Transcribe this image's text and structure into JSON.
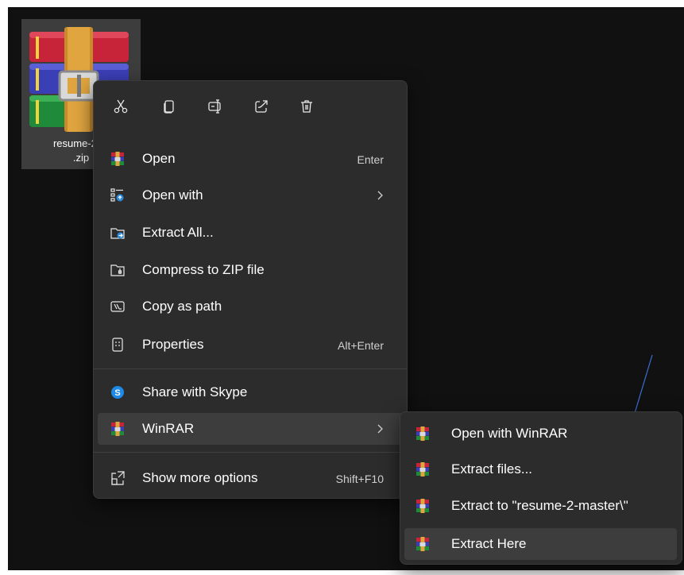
{
  "file": {
    "name": "resume-2-m\n.zip",
    "icon": "winrar-archive-icon"
  },
  "quick_actions": [
    {
      "name": "cut",
      "icon": "scissors-icon"
    },
    {
      "name": "copy",
      "icon": "copy-icon"
    },
    {
      "name": "rename",
      "icon": "rename-icon"
    },
    {
      "name": "share",
      "icon": "share-icon"
    },
    {
      "name": "delete",
      "icon": "trash-icon"
    }
  ],
  "menu": {
    "items": [
      {
        "label": "Open",
        "shortcut": "Enter",
        "icon": "winrar-icon"
      },
      {
        "label": "Open with",
        "icon": "open-with-icon",
        "submenu": true
      },
      {
        "label": "Extract All...",
        "icon": "extract-folder-icon"
      },
      {
        "label": "Compress to ZIP file",
        "icon": "zip-folder-icon"
      },
      {
        "label": "Copy as path",
        "icon": "copy-path-icon"
      },
      {
        "label": "Properties",
        "shortcut": "Alt+Enter",
        "icon": "properties-icon"
      },
      {
        "label": "Share with Skype",
        "icon": "skype-icon"
      },
      {
        "label": "WinRAR",
        "icon": "winrar-icon",
        "submenu": true,
        "active": true
      },
      {
        "label": "Show more options",
        "shortcut": "Shift+F10",
        "icon": "more-options-icon"
      }
    ]
  },
  "submenu": {
    "items": [
      {
        "label": "Open with WinRAR",
        "icon": "winrar-icon"
      },
      {
        "label": "Extract files...",
        "icon": "winrar-icon"
      },
      {
        "label": "Extract to \"resume-2-master\\\"",
        "icon": "winrar-icon"
      },
      {
        "label": "Extract Here",
        "icon": "winrar-icon",
        "hover": true
      }
    ]
  },
  "colors": {
    "desktop": "#111111",
    "menu_bg": "#2c2c2c",
    "highlight": "#3d3d3d",
    "annotation_arrow": "#3b6fd4"
  }
}
